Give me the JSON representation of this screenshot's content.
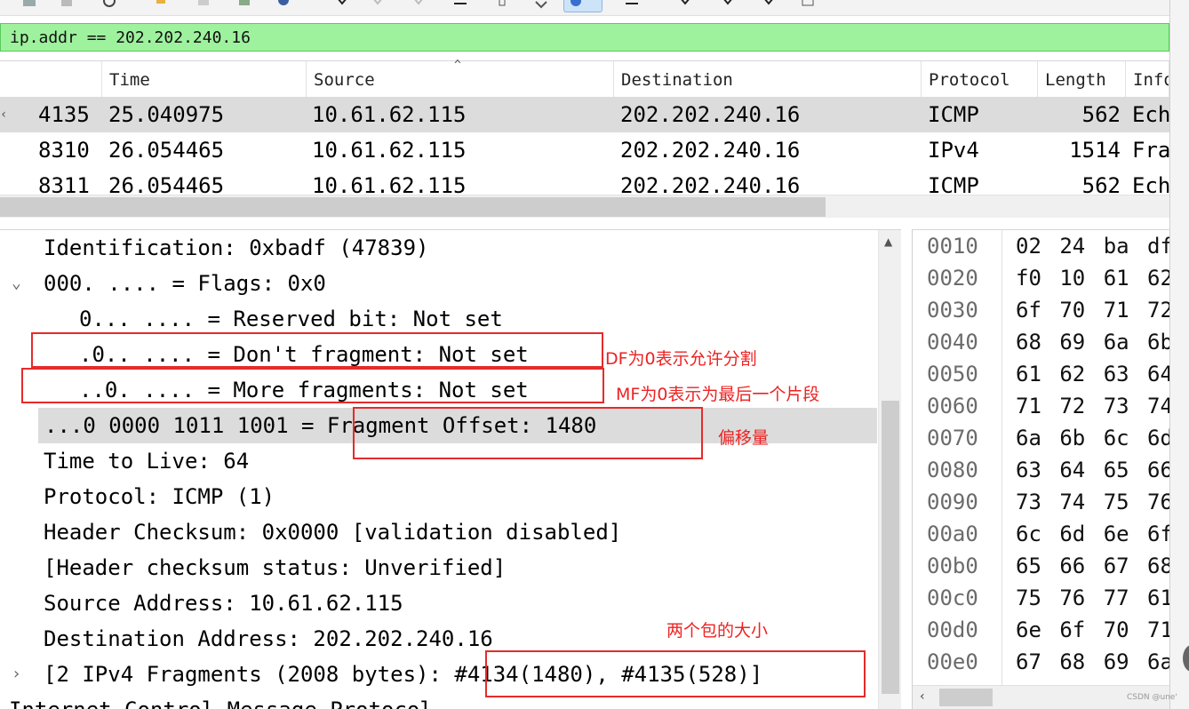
{
  "filter": {
    "text": "ip.addr == 202.202.240.16"
  },
  "packet_list": {
    "columns": [
      "Time",
      "Source",
      "Destination",
      "Protocol",
      "Length",
      "Info"
    ],
    "rows": [
      {
        "no": "4135",
        "time": "25.040975",
        "source": "10.61.62.115",
        "destination": "202.202.240.16",
        "protocol": "ICMP",
        "length": "562",
        "info": "Ech"
      },
      {
        "no": "8310",
        "time": "26.054465",
        "source": "10.61.62.115",
        "destination": "202.202.240.16",
        "protocol": "IPv4",
        "length": "1514",
        "info": "Fra"
      },
      {
        "no": "8311",
        "time": "26.054465",
        "source": "10.61.62.115",
        "destination": "202.202.240.16",
        "protocol": "ICMP",
        "length": "562",
        "info": "Ech"
      }
    ]
  },
  "details": {
    "lines": [
      "Identification: 0xbadf (47839)",
      "000. .... = Flags: 0x0",
      "0... .... = Reserved bit: Not set",
      ".0.. .... = Don't fragment: Not set",
      "..0. .... = More fragments: Not set",
      "...0 0000 1011 1001 = Fragment Offset: 1480",
      "Time to Live: 64",
      "Protocol: ICMP (1)",
      "Header Checksum: 0x0000 [validation disabled]",
      "[Header checksum status: Unverified]",
      "Source Address: 10.61.62.115",
      "Destination Address: 202.202.240.16",
      "[2 IPv4 Fragments (2008 bytes): #4134(1480), #4135(528)]",
      "Internet Control Message Protocol"
    ],
    "twisty_expanded": "⌄",
    "twisty_collapsed": "›"
  },
  "annotations": {
    "df": "DF为0表示允许分割",
    "mf": "MF为0表示为最后一个片段",
    "offset": "偏移量",
    "fragments": "两个包的大小"
  },
  "hex": {
    "rows": [
      {
        "offset": "0010",
        "bytes": "02 24 ba df"
      },
      {
        "offset": "0020",
        "bytes": "f0 10 61 62"
      },
      {
        "offset": "0030",
        "bytes": "6f 70 71 72"
      },
      {
        "offset": "0040",
        "bytes": "68 69 6a 6b"
      },
      {
        "offset": "0050",
        "bytes": "61 62 63 64"
      },
      {
        "offset": "0060",
        "bytes": "71 72 73 74"
      },
      {
        "offset": "0070",
        "bytes": "6a 6b 6c 6d"
      },
      {
        "offset": "0080",
        "bytes": "63 64 65 66"
      },
      {
        "offset": "0090",
        "bytes": "73 74 75 76"
      },
      {
        "offset": "00a0",
        "bytes": "6c 6d 6e 6f"
      },
      {
        "offset": "00b0",
        "bytes": "65 66 67 68"
      },
      {
        "offset": "00c0",
        "bytes": "75 76 77 61"
      },
      {
        "offset": "00d0",
        "bytes": "6e 6f 70 71"
      },
      {
        "offset": "00e0",
        "bytes": "67 68 69 6a"
      }
    ]
  },
  "watermark": "CSDN @une'",
  "colors": {
    "filter_bg": "#9ef29e",
    "annotation_red": "#e52b2b",
    "selected_row": "#dcdcdc"
  }
}
